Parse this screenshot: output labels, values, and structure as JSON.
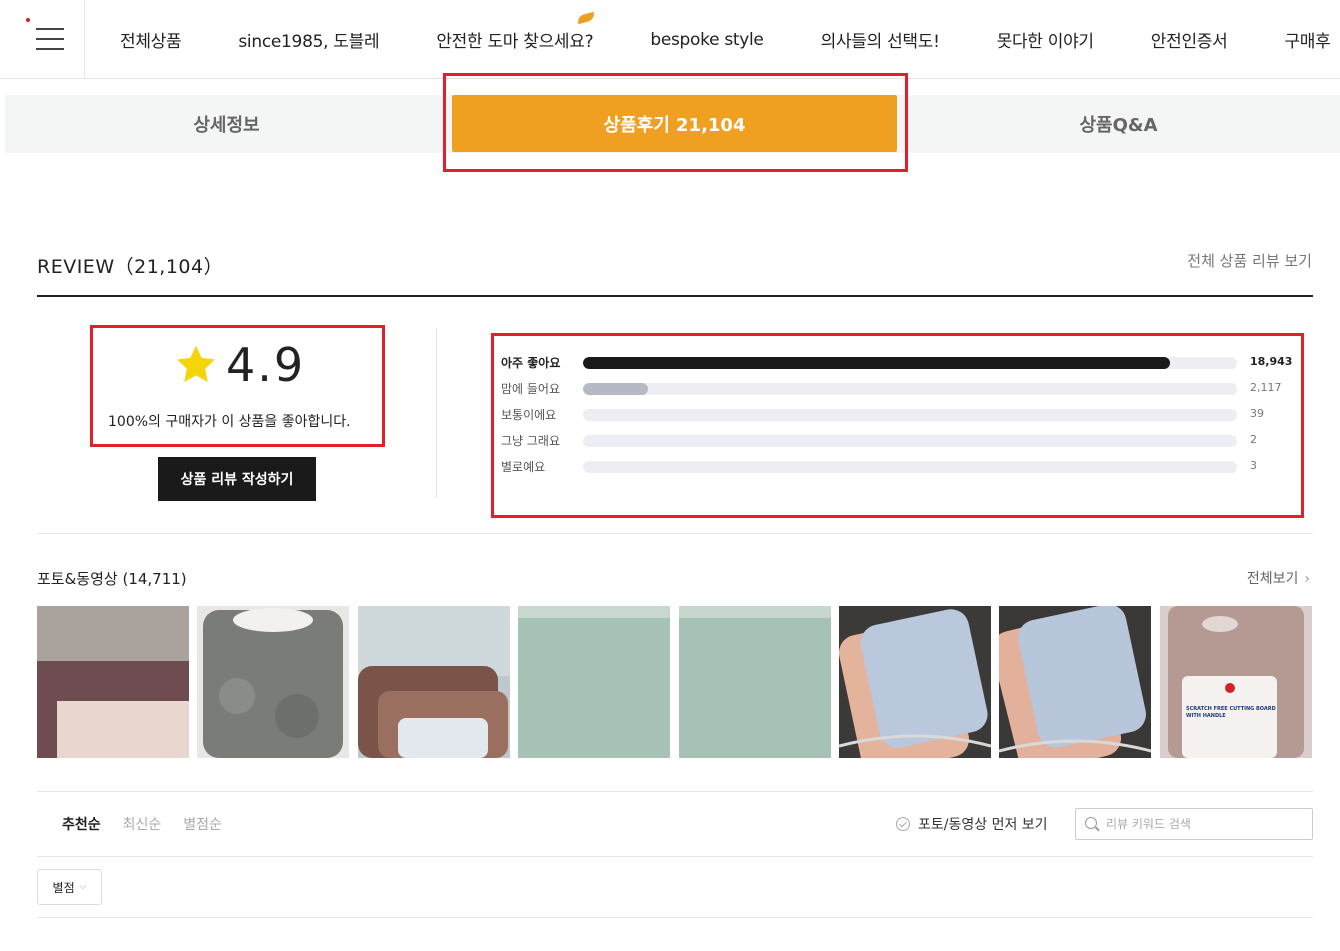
{
  "nav": {
    "items": [
      "전체상품",
      "since1985, 도블레",
      "안전한 도마 찾으세요?",
      "bespoke style",
      "의사들의 선택도!",
      "못다한 이야기",
      "안전인증서",
      "구매후"
    ]
  },
  "tabs": {
    "detail": "상세정보",
    "review": "상품후기 21,104",
    "qna": "상품Q&A"
  },
  "review": {
    "title": "REVIEW（21,104）",
    "view_all": "전체 상품 리뷰 보기",
    "score": "4.9",
    "satisfaction": "100%의 구매자가 이 상품을 좋아합니다.",
    "write_button": "상품 리뷰 작성하기",
    "accent_color": "#f0a020",
    "star_color": "#f5d50a"
  },
  "rating_bars": [
    {
      "label": "아주 좋아요",
      "count": "18,943",
      "fraction": 0.898
    },
    {
      "label": "맘에 들어요",
      "count": "2,117",
      "fraction": 0.1
    },
    {
      "label": "보통이에요",
      "count": "39",
      "fraction": 0
    },
    {
      "label": "그냥 그래요",
      "count": "2",
      "fraction": 0
    },
    {
      "label": "별로예요",
      "count": "3",
      "fraction": 0
    }
  ],
  "photos": {
    "title": "포토&동영상 (14,711)",
    "view_all": "전체보기",
    "items": [
      "brown-board-photo",
      "gray-board-photo",
      "stacked-boards-photo",
      "mint-board-photo",
      "mint-board-photo-2",
      "pink-blue-board-rack-photo",
      "blue-board-rack-photo",
      "packaged-board-photo"
    ],
    "package_text_1": "SCRATCH FREE CUTTING BOARD",
    "package_text_2": "WITH HANDLE"
  },
  "sort": {
    "options": [
      "추천순",
      "최신순",
      "별점순"
    ],
    "active": 0,
    "photo_first": "포토/동영상 먼저 보기",
    "search_placeholder": "리뷰 키워드 검색",
    "filter_label": "별점"
  }
}
